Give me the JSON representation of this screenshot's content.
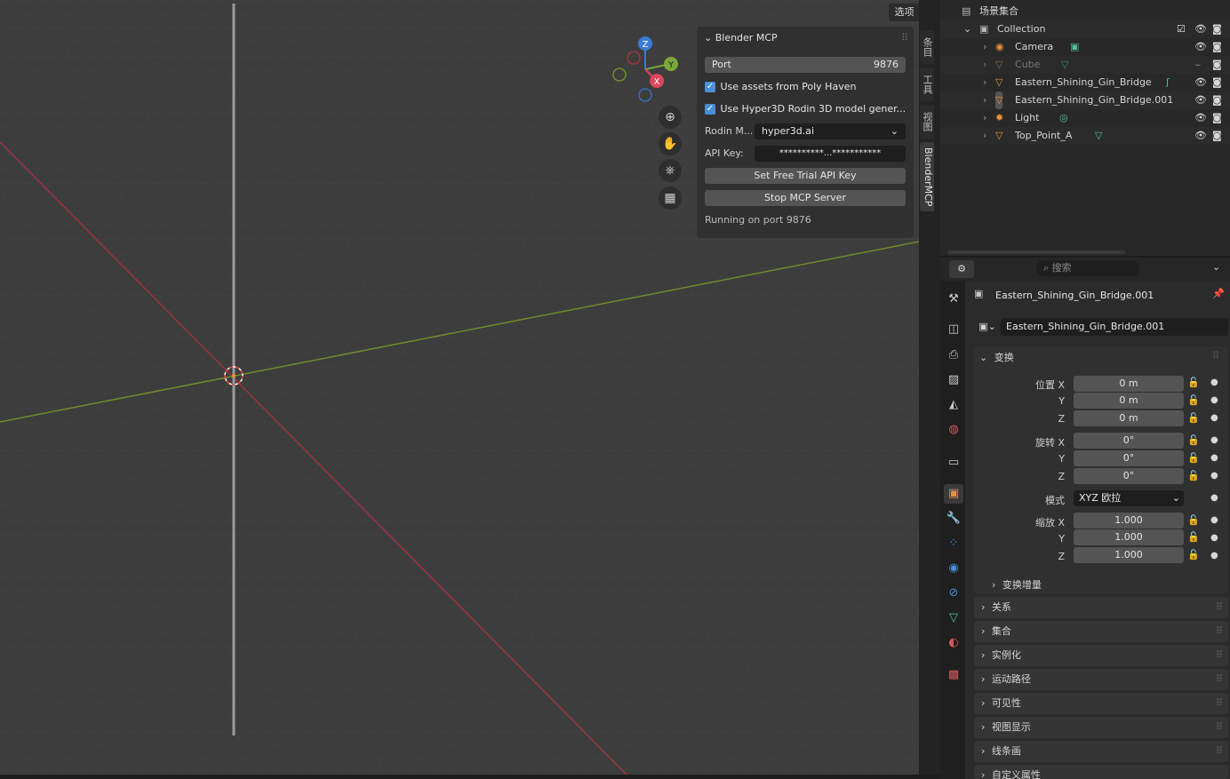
{
  "viewport": {
    "options_label": "选项",
    "side_tabs": [
      "条目",
      "工具",
      "视图",
      "BlenderMCP"
    ],
    "gizmo": {
      "z": "Z",
      "y": "Y",
      "x": "X"
    }
  },
  "mcp_panel": {
    "title": "Blender MCP",
    "port_label": "Port",
    "port_value": "9876",
    "use_poly_haven": "Use assets from Poly Haven",
    "use_hyper3d": "Use Hyper3D Rodin 3D model gener...",
    "rodin_mode_label": "Rodin M...",
    "rodin_mode_value": "hyper3d.ai",
    "api_key_label": "API Key:",
    "api_key_value": "**********...***********",
    "set_trial_key_button": "Set Free Trial API Key",
    "stop_server_button": "Stop MCP Server",
    "status": "Running on port 9876"
  },
  "outliner": {
    "root": "场景集合",
    "collection": "Collection",
    "items": [
      {
        "name": "Camera"
      },
      {
        "name": "Cube"
      },
      {
        "name": "Eastern_Shining_Gin_Bridge"
      },
      {
        "name": "Eastern_Shining_Gin_Bridge.001"
      },
      {
        "name": "Light"
      },
      {
        "name": "Top_Point_A"
      }
    ]
  },
  "properties": {
    "search_placeholder": "搜索",
    "object_name": "Eastern_Shining_Gin_Bridge.001",
    "object_field": "Eastern_Shining_Gin_Bridge.001",
    "transform_section": "变换",
    "location_label": "位置 X",
    "rotation_label": "旋转 X",
    "scale_label": "缩放 X",
    "axis_y": "Y",
    "axis_z": "Z",
    "location": [
      "0 m",
      "0 m",
      "0 m"
    ],
    "rotation": [
      "0°",
      "0°",
      "0°"
    ],
    "mode_label": "模式",
    "mode_value": "XYZ 欧拉",
    "scale": [
      "1.000",
      "1.000",
      "1.000"
    ],
    "delta_transform": "变换增量",
    "sections": [
      "关系",
      "集合",
      "实例化",
      "运动路径",
      "可见性",
      "视图显示",
      "线条画",
      "自定义属性"
    ]
  },
  "colors": {
    "accent": "#4a8fd9",
    "selected_row": "#334d80",
    "x_axis": "#a4333d",
    "y_axis": "#6a8c2a",
    "object_orange": "#e8913a"
  }
}
